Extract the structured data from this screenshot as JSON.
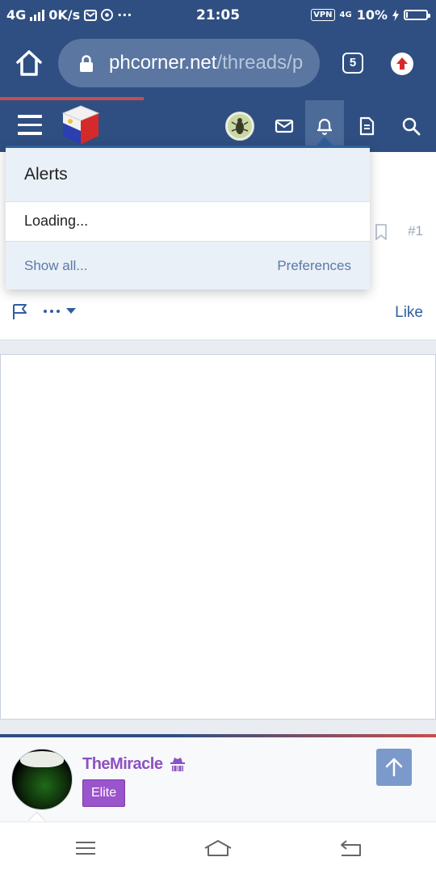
{
  "status_bar": {
    "network": "4G",
    "speed": "0K/s",
    "more": "···",
    "time": "21:05",
    "vpn": "VPN",
    "network_right": "4G",
    "battery_text": "10%",
    "battery_level": 0.1
  },
  "browser": {
    "url_host": "phcorner.net",
    "url_path": "/threads/p",
    "tab_count": "5"
  },
  "page_load_progress": 0.33,
  "post": {
    "number": "#1",
    "like_label": "Like"
  },
  "alerts_popup": {
    "title": "Alerts",
    "loading_text": "Loading...",
    "show_all_label": "Show all...",
    "preferences_label": "Preferences"
  },
  "user_card": {
    "username": "TheMiracle",
    "user_title": "Elite"
  },
  "colors": {
    "brand_blue": "#2f4f82",
    "accent_red": "#c74d4d",
    "link_blue": "#2f5f9e",
    "username_purple": "#8e50c2",
    "badge_purple": "#9a54cc"
  }
}
